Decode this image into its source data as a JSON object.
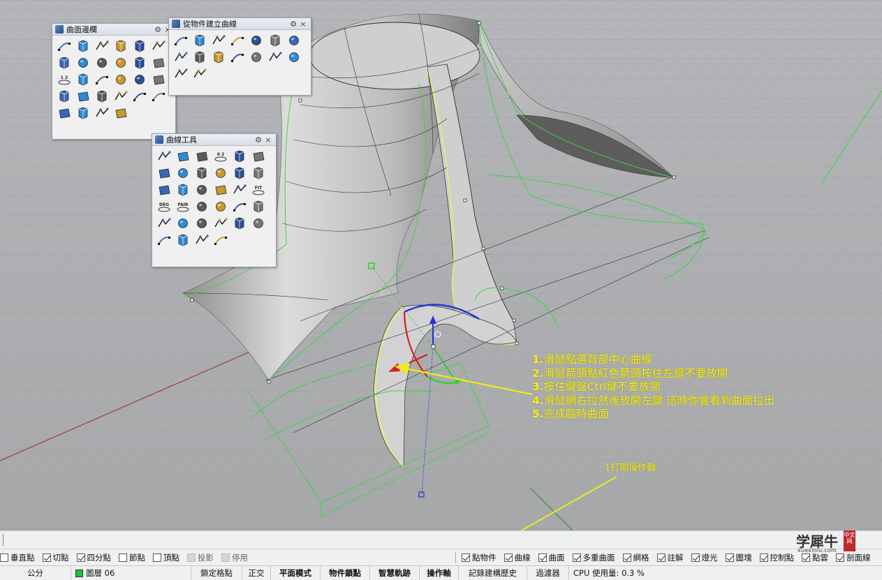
{
  "panels": {
    "surface": {
      "title": "曲面邊欄",
      "gear": "⚙",
      "close": "×"
    },
    "from_object": {
      "title": "從物件建立曲線",
      "gear": "⚙",
      "close": "×"
    },
    "curve_tools": {
      "title": "曲線工具",
      "gear": "⚙",
      "close": "×"
    }
  },
  "icons": {
    "surface": [
      "select-arrow",
      "corner-points-surface",
      "edge-curves-surface",
      "extrude-curve",
      "patch",
      "fan-surface",
      "plane-rect",
      "grid-surface",
      "sphere",
      "sweep-1",
      "sweep-2",
      "revolve",
      "loft",
      "network",
      "surface-from-points",
      "blend",
      "offset",
      "twist",
      "cap",
      "cone",
      "pyramid",
      "bend",
      "ellipsoid",
      "fillet-surface",
      "tab",
      "unroll",
      "cube-mesh",
      "point-grid"
    ],
    "from_object": [
      "duplicate-edge",
      "duplicate-border",
      "project",
      "pull",
      "intersect",
      "contour",
      "section",
      "silhouette",
      "extract-isocurve",
      "create-uv",
      "extract-wireframe",
      "unroll-curve",
      "point-cloud",
      "mesh-outline",
      "flow-along",
      "isometric-box"
    ],
    "curve_tools": [
      "fillet-curve",
      "chamfer",
      "blend-curve",
      "match-curve",
      "adjust-seam",
      "symmetry",
      "offset-curve",
      "arc-blend",
      "sphere-tool",
      "extend-curve",
      "dotted-line",
      "rebuild",
      "connect",
      "weld",
      "tween",
      "walk",
      "climb",
      "fit",
      "degree",
      "fair",
      "control-pts",
      "bracket",
      "insert-point",
      "rotate-pt",
      "pointer",
      "x-delete",
      "arrow-right",
      "corner",
      "dot-insert",
      "mesh-cap",
      "arc-simple",
      "cylinder-rect",
      "sphere-small",
      "cylinder-small"
    ],
    "surface_labels": {
      "loft": "1 2"
    },
    "curve_labels": {
      "fit": "FIT",
      "degree": "DEG",
      "fair": "FAIR",
      "match-curve": "0 2"
    }
  },
  "callout": {
    "lines": [
      {
        "num": "1.",
        "text": "滑鼠點選背部中心曲線"
      },
      {
        "num": "2.",
        "text": "滑鼠箭頭點紅色箭頭按住左鍵不要放開"
      },
      {
        "num": "3.",
        "text": "按住鍵盤Ctrl鍵不要放開"
      },
      {
        "num": "4.",
        "text": "滑鼠網右拉然後放開左鍵 這時你會看到曲面拉出"
      },
      {
        "num": "5.",
        "text": "完成臨時曲面"
      }
    ],
    "step_label": "1打開操作軸",
    "color": "#f7ef23"
  },
  "osnap_left": [
    {
      "label": "垂直點",
      "checked": false
    },
    {
      "label": "切點",
      "checked": true
    },
    {
      "label": "四分點",
      "checked": true
    },
    {
      "label": "節點",
      "checked": false
    },
    {
      "label": "頂點",
      "checked": false
    },
    {
      "label": "投影",
      "checked": false,
      "disabled": true
    },
    {
      "label": "停用",
      "checked": false,
      "disabled": true
    }
  ],
  "osnap_right": [
    {
      "label": "點物件",
      "checked": true
    },
    {
      "label": "曲線",
      "checked": true
    },
    {
      "label": "曲面",
      "checked": true
    },
    {
      "label": "多重曲面",
      "checked": true
    },
    {
      "label": "網格",
      "checked": true
    },
    {
      "label": "註解",
      "checked": true
    },
    {
      "label": "燈光",
      "checked": true
    },
    {
      "label": "圖塊",
      "checked": true
    },
    {
      "label": "控制點",
      "checked": true
    },
    {
      "label": "點雲",
      "checked": true
    },
    {
      "label": "剖面線",
      "checked": true
    }
  ],
  "status": {
    "units": "公分",
    "layer": "圖層 06",
    "layer_color": "#19c039",
    "grid_snap": "鎖定格點",
    "ortho": "正交",
    "planar": "平面模式",
    "osnap": "物件鎖點",
    "smart_track": "智慧軌跡",
    "gumball": "操作軸",
    "history": "記錄建構歷史",
    "filter": "過濾器",
    "cpu_label": "CPU 使用量: 0.3 %"
  },
  "watermark": {
    "main": "学犀牛",
    "seal": "中文网",
    "url": "xuexiniu.com"
  }
}
